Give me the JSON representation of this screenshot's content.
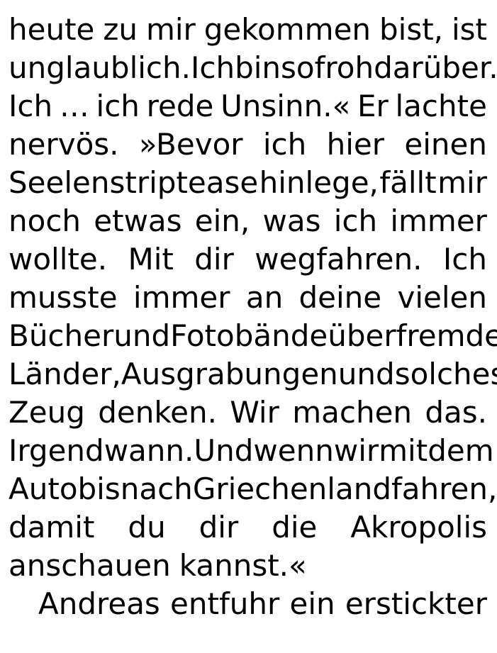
{
  "lines": [
    {
      "words": [
        "heute",
        "zu",
        "mir",
        "gekommen",
        "bist,",
        "ist"
      ],
      "justify": true,
      "indent": false
    },
    {
      "words": [
        "unglaublich.",
        "Ich",
        "bin",
        "so",
        "froh",
        "darüber."
      ],
      "justify": true,
      "indent": false
    },
    {
      "words": [
        "Ich",
        "…",
        "ich",
        "rede",
        "Unsinn.«",
        "Er",
        "lachte"
      ],
      "justify": true,
      "indent": false
    },
    {
      "words": [
        "nervös.",
        "»Bevor",
        "ich",
        "hier",
        "einen"
      ],
      "justify": true,
      "indent": false
    },
    {
      "words": [
        "Seelenstriptease",
        "hinlege,",
        "fällt",
        "mir"
      ],
      "justify": true,
      "indent": false
    },
    {
      "words": [
        "noch",
        "etwas",
        "ein,",
        "was",
        "ich",
        "immer"
      ],
      "justify": true,
      "indent": false
    },
    {
      "words": [
        "wollte.",
        "Mit",
        "dir",
        "wegfahren.",
        "Ich"
      ],
      "justify": true,
      "indent": false
    },
    {
      "words": [
        "musste",
        "immer",
        "an",
        "deine",
        "vielen"
      ],
      "justify": true,
      "indent": false
    },
    {
      "words": [
        "Bücher",
        "und",
        "Fotobände",
        "über",
        "fremde"
      ],
      "justify": true,
      "indent": false
    },
    {
      "words": [
        "Länder,",
        "Ausgrabungen",
        "und",
        "solches"
      ],
      "justify": true,
      "indent": false
    },
    {
      "words": [
        "Zeug",
        "denken.",
        "Wir",
        "machen",
        "das."
      ],
      "justify": true,
      "indent": false
    },
    {
      "words": [
        "Irgendwann.",
        "Und",
        "wenn",
        "wir",
        "mit",
        "dem"
      ],
      "justify": true,
      "indent": false
    },
    {
      "words": [
        "Auto",
        "bis",
        "nach",
        "Griechenland",
        "fahren,"
      ],
      "justify": true,
      "indent": false
    },
    {
      "words": [
        "damit",
        "du",
        "dir",
        "die",
        "Akropolis"
      ],
      "justify": true,
      "indent": false
    },
    {
      "words": [
        "anschauen",
        "kannst.«"
      ],
      "justify": false,
      "indent": false
    },
    {
      "words": [
        "Andreas",
        "entfuhr",
        "ein",
        "erstickter"
      ],
      "justify": true,
      "indent": true
    }
  ]
}
